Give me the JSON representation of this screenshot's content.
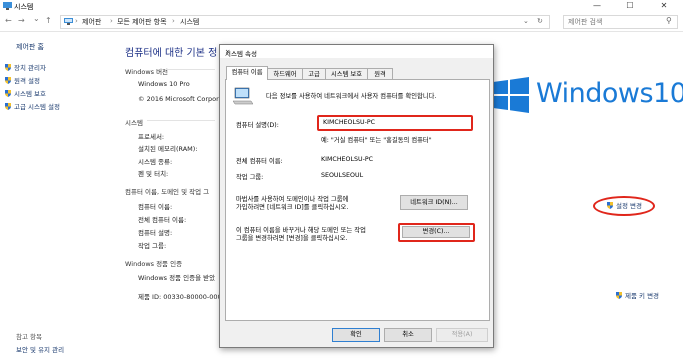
{
  "window": {
    "title": "시스템",
    "minimize": "—",
    "maximize": "☐",
    "close": "✕"
  },
  "addressbar": {
    "back": "←",
    "forward": "→",
    "up_recent": "⌄",
    "up": "↑",
    "crumb_sep": "›",
    "crumbs": [
      "제어판",
      "모든 제어판 항목",
      "시스템"
    ],
    "dropdown": "⌄",
    "refresh": "↻",
    "search_placeholder": "제어판 검색",
    "search_icon": "⚲"
  },
  "sidebar": {
    "home": "제어판 홈",
    "items": [
      {
        "label": "장치 관리자",
        "icon": "shield-icon"
      },
      {
        "label": "원격 설정",
        "icon": "shield-icon"
      },
      {
        "label": "시스템 보호",
        "icon": "shield-icon"
      },
      {
        "label": "고급 시스템 설정",
        "icon": "shield-icon"
      }
    ],
    "see_also": "참고 항목",
    "security_maintenance": "보안 및 유지 관리"
  },
  "main": {
    "heading": "컴퓨터에 대한 기본 정",
    "edition_section": "Windows 버전",
    "edition": "Windows 10 Pro",
    "copyright": "© 2016 Microsoft Corpora",
    "system_section": "시스템",
    "system_rows": [
      "프로세서:",
      "설치된 메모리(RAM):",
      "시스템 종류:",
      "펜 및 터치:"
    ],
    "computer_section": "컴퓨터 이름, 도메인 및 작업 그",
    "computer_rows": [
      "컴퓨터 이름:",
      "전체 컴퓨터 이름:",
      "컴퓨터 설명:",
      "작업 그룹:"
    ],
    "change_settings": "설정 변경",
    "activation_section": "Windows 정품 인증",
    "activation_text": "Windows 정품 인증을 받았",
    "product_id": "제품 ID: 00330-80000-000",
    "product_key_change": "제품 키 변경",
    "windows_brand": "Windows10"
  },
  "dialog": {
    "title": "시스템 속성",
    "close": "✕",
    "tabs": [
      "컴퓨터 이름",
      "하드웨어",
      "고급",
      "시스템 보호",
      "원격"
    ],
    "intro": "다음 정보를 사용하여 네트워크에서 사용자 컴퓨터를 확인합니다.",
    "description_label": "컴퓨터 설명(D):",
    "description_value": "KIMCHEOLSU-PC",
    "description_example": "예: \"거실 컴퓨터\" 또는 \"홍길동의 컴퓨터\"",
    "fullname_label": "전체 컴퓨터 이름:",
    "fullname_value": "KIMCHEOLSU-PC",
    "workgroup_label": "작업 그룹:",
    "workgroup_value": "SEOULSEOUL",
    "wizard_text_1": "마법사를 사용하여 도메인이나 작업 그룹에",
    "wizard_text_2": "가입하려면 [네트워크 ID]를 클릭하십시오.",
    "network_id_button": "네트워크 ID(N)...",
    "rename_text_1": "이 컴퓨터 이름을 바꾸거나 해당 도메인 또는 작업",
    "rename_text_2": "그룹을 변경하려면 [변경]을 클릭하십시오.",
    "change_button": "변경(C)...",
    "ok_button": "확인",
    "cancel_button": "취소",
    "apply_button": "적용(A)"
  }
}
